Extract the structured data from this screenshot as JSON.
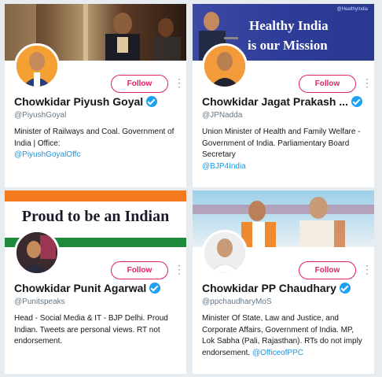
{
  "cards": [
    {
      "name": "Chowkidar Piyush Goyal",
      "handle": "@PiyushGoyal",
      "bio": "Minister of Railways and Coal. Government of India | Office:",
      "bio_link": "@PiyushGoyalOffc",
      "follow_label": "Follow"
    },
    {
      "name": "Chowkidar Jagat Prakash ...",
      "handle": "@JPNadda",
      "bio": "Union Minister of Health and Family Welfare - Government of India. Parliamentary Board Secretary",
      "bio_link": "@BJP4India",
      "follow_label": "Follow",
      "banner_text_1": "Healthy India",
      "banner_text_2": "is our Mission",
      "banner_tag": "@HealthyIndia"
    },
    {
      "name": "Chowkidar Punit Agarwal",
      "handle": "@Punitspeaks",
      "bio": "Head - Social Media & IT - BJP Delhi. Proud Indian. Tweets are personal views. RT not endorsement.",
      "bio_link": "",
      "follow_label": "Follow",
      "banner_text_1": "Proud to be an Indian"
    },
    {
      "name": "Chowkidar PP Chaudhary",
      "handle": "@ppchaudharyMoS",
      "bio": "Minister Of State, Law and Justice, and Corporate Affairs, Government of India. MP, Lok Sabha (Pali, Rajasthan). RTs do not imply endorsement.",
      "bio_link": "@OfficeofPPC",
      "follow_label": "Follow"
    }
  ],
  "colors": {
    "follow": "#e0245e",
    "link": "#1b95e0",
    "verified": "#1da1f2",
    "background": "#e6ecf0"
  }
}
